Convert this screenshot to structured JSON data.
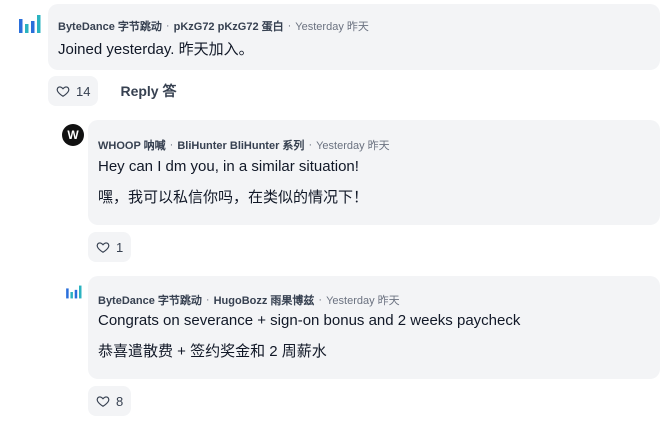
{
  "comments": [
    {
      "company": "ByteDance 字节跳动",
      "author": "pKzG72 pKzG72 蛋白",
      "time": "Yesterday 昨天",
      "lines": [
        "Joined yesterday. 昨天加入。"
      ],
      "likes": "14",
      "reply_label": "Reply 答"
    },
    {
      "company": "WHOOP 呐喊",
      "author": "BliHunter BliHunter 系列",
      "time": "Yesterday 昨天",
      "lines": [
        "Hey can I dm you, in a similar situation!",
        "嘿，我可以私信你吗，在类似的情况下！"
      ],
      "likes": "1",
      "avatar_letter": "W"
    },
    {
      "company": "ByteDance 字节跳动",
      "author": "HugoBozz 雨果博兹",
      "time": "Yesterday 昨天",
      "lines": [
        "Congrats on severance + sign-on bonus and 2 weeks paycheck",
        "恭喜遣散费 + 签约奖金和 2 周薪水"
      ],
      "likes": "8"
    }
  ],
  "separator": "·",
  "colors": {
    "bubble": "#f3f4f6",
    "bytedance_blue": "#2a6fdb",
    "bytedance_teal": "#2bb3c0"
  }
}
